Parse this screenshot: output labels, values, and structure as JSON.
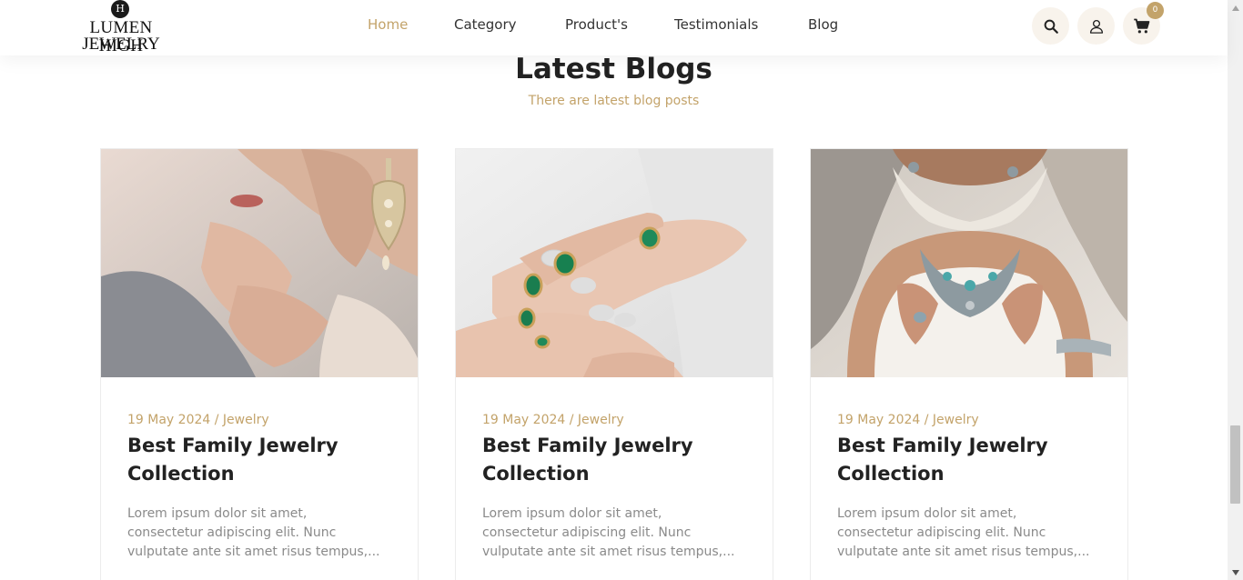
{
  "brand": {
    "mark": "H",
    "line1": "LUMEN HIGH",
    "line2": "JEWELRY"
  },
  "nav": {
    "items": [
      {
        "label": "Home",
        "active": true
      },
      {
        "label": "Category",
        "active": false
      },
      {
        "label": "Product's",
        "active": false
      },
      {
        "label": "Testimonials",
        "active": false
      },
      {
        "label": "Blog",
        "active": false
      }
    ]
  },
  "header_actions": {
    "search_icon": "search-icon",
    "user_icon": "user-icon",
    "cart_icon": "cart-icon",
    "cart_count": "0"
  },
  "section": {
    "title": "Latest Blogs",
    "subtitle": "There are latest blog posts"
  },
  "posts": [
    {
      "image": "woman-with-chandelier-earrings",
      "date": "19 May 2024",
      "separator": "/",
      "category": "Jewelry",
      "title_line1": "Best Family Jewelry",
      "title_line2": "Collection",
      "excerpt_line1": "Lorem ipsum dolor sit amet,",
      "excerpt_line2": "consectetur adipiscing elit. Nunc",
      "excerpt_line3": "vulputate ante sit amet risus tempus,..."
    },
    {
      "image": "hands-with-emerald-rings",
      "date": "19 May 2024",
      "separator": "/",
      "category": "Jewelry",
      "title_line1": "Best Family Jewelry",
      "title_line2": "Collection",
      "excerpt_line1": "Lorem ipsum dolor sit amet,",
      "excerpt_line2": "consectetur adipiscing elit. Nunc",
      "excerpt_line3": "vulputate ante sit amet risus tempus,..."
    },
    {
      "image": "woman-with-silver-necklace",
      "date": "19 May 2024",
      "separator": "/",
      "category": "Jewelry",
      "title_line1": "Best Family Jewelry",
      "title_line2": "Collection",
      "excerpt_line1": "Lorem ipsum dolor sit amet,",
      "excerpt_line2": "consectetur adipiscing elit. Nunc",
      "excerpt_line3": "vulputate ante sit amet risus tempus,..."
    }
  ],
  "colors": {
    "accent": "#c3a36a",
    "text": "#222222",
    "muted": "#8a8a8a",
    "icon_bg": "#f8f3ec"
  }
}
